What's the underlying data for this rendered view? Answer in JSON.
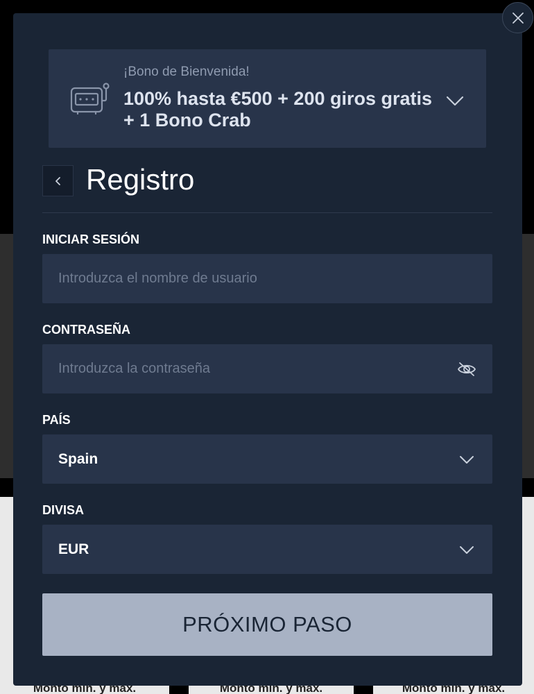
{
  "background": {
    "cards": [
      {
        "label": "Monto mín. y máx."
      },
      {
        "label": "Monto mín. y máx."
      },
      {
        "label": "Monto mín. y máx."
      }
    ]
  },
  "bonus": {
    "kicker": "¡Bono de Bienvenida!",
    "title": "100% hasta €500 + 200 giros gratis + 1 Bono Crab",
    "icon": "slot-machine-icon"
  },
  "header": {
    "title": "Registro"
  },
  "form": {
    "username": {
      "label": "INICIAR SESIÓN",
      "value": "",
      "placeholder": "Introduzca el nombre de usuario"
    },
    "password": {
      "label": "CONTRASEÑA",
      "value": "",
      "placeholder": "Introduzca la contraseña",
      "toggle_icon": "eye-off-icon"
    },
    "country": {
      "label": "PAÍS",
      "selected": "Spain"
    },
    "currency": {
      "label": "DIVISA",
      "selected": "EUR"
    },
    "submit_label": "PRÓXIMO PASO"
  },
  "colors": {
    "modal_bg": "#1a2535",
    "field_bg": "#28344a",
    "button_bg": "#a8b2c4",
    "text_muted": "#6f7b90"
  }
}
